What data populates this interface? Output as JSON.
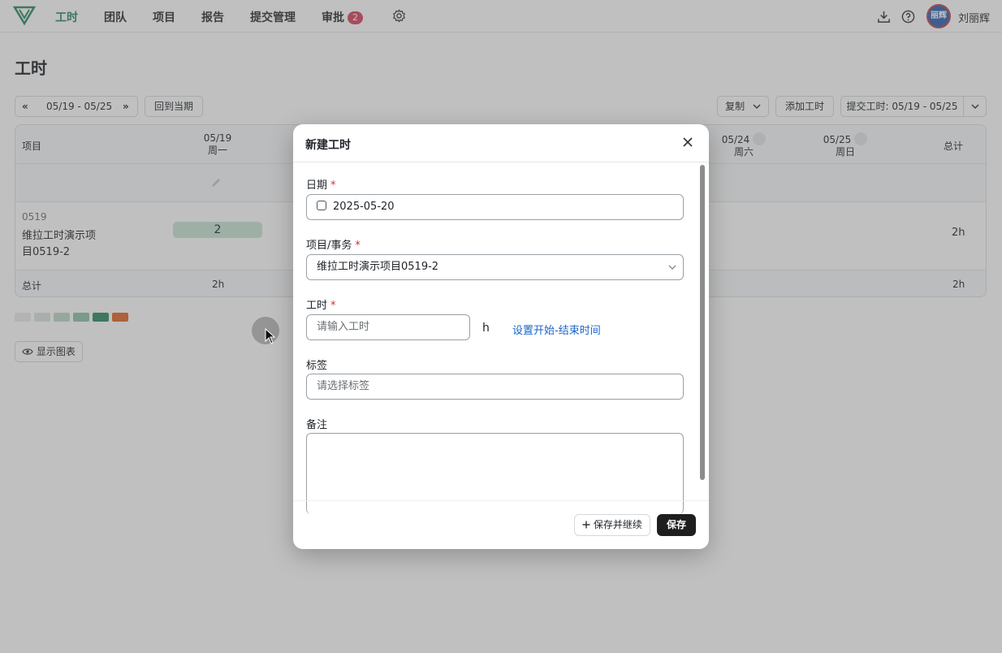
{
  "nav": {
    "items": [
      "工时",
      "团队",
      "项目",
      "报告",
      "提交管理",
      "审批"
    ],
    "approval_badge": "2",
    "avatar_text": "丽辉",
    "username": "刘丽辉"
  },
  "page": {
    "title": "工时"
  },
  "toolbar": {
    "prev": "«",
    "range": "05/19 - 05/25",
    "next": "»",
    "current_period": "回到当期",
    "copy": "复制",
    "add_time": "添加工时",
    "submit": "提交工时: 05/19 - 05/25"
  },
  "grid": {
    "project_header": "项目",
    "total_header": "总计",
    "mon_date": "05/19",
    "mon_day": "周一",
    "sat_date": "05/24",
    "sat_day": "周六",
    "sun_date": "05/25",
    "sun_day": "周日",
    "row_code": "0519",
    "row_name_1": "维拉工时演示项",
    "row_name_2": "目0519-2",
    "row_mon_value": "2",
    "row_total": "2h",
    "total_label": "总计",
    "total_mon": "2h",
    "total_all": "2h"
  },
  "legend_colors": [
    "#e7ece9",
    "#d8e6dd",
    "#bcd8c6",
    "#8fc3a6",
    "#2e8a63",
    "#e0662a"
  ],
  "show_chart": "显示图表",
  "modal": {
    "title": "新建工时",
    "date_label": "日期",
    "date_value": "2025-05-20",
    "project_label": "项目/事务",
    "project_value": "维拉工时演示项目0519-2",
    "hours_label": "工时",
    "hours_placeholder": "请输入工时",
    "hours_unit": "h",
    "set_time_link": "设置开始-结束时间",
    "tags_label": "标签",
    "tags_placeholder": "请选择标签",
    "notes_label": "备注",
    "required_mark": "*",
    "save_continue": "保存并继续",
    "save": "保存"
  }
}
